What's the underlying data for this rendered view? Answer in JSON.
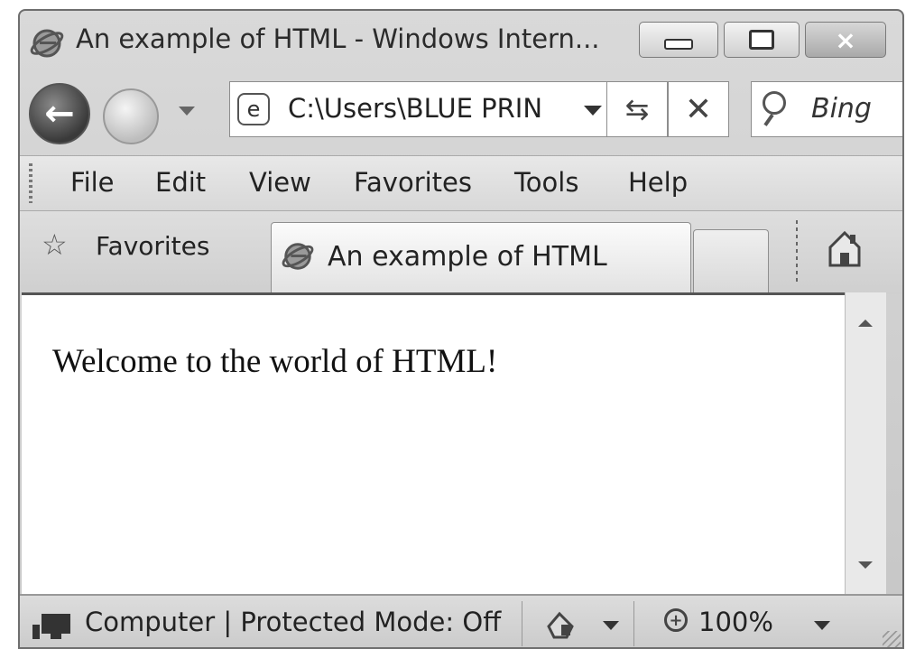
{
  "window": {
    "title": "An example of HTML - Windows Intern...",
    "controls": {
      "minimize_icon": "minimize-icon",
      "maximize_icon": "maximize-icon",
      "close_glyph": "×"
    }
  },
  "nav": {
    "address": "C:\\Users\\BLUE PRIN",
    "search_placeholder": "Bing",
    "refresh_glyph": "⇆",
    "stop_glyph": "✕"
  },
  "menu": {
    "items": [
      "File",
      "Edit",
      "View",
      "Favorites",
      "Tools",
      "Help"
    ]
  },
  "favorites_bar": {
    "favorites_label": "Favorites",
    "tab_label": "An example of HTML"
  },
  "page": {
    "body_text": "Welcome to the world of HTML!"
  },
  "status": {
    "zone_text": "Computer | Protected Mode: Off",
    "zoom_level": "100%"
  },
  "colors": {
    "chrome_bg": "#d9d9d9",
    "content_bg": "#ffffff"
  }
}
